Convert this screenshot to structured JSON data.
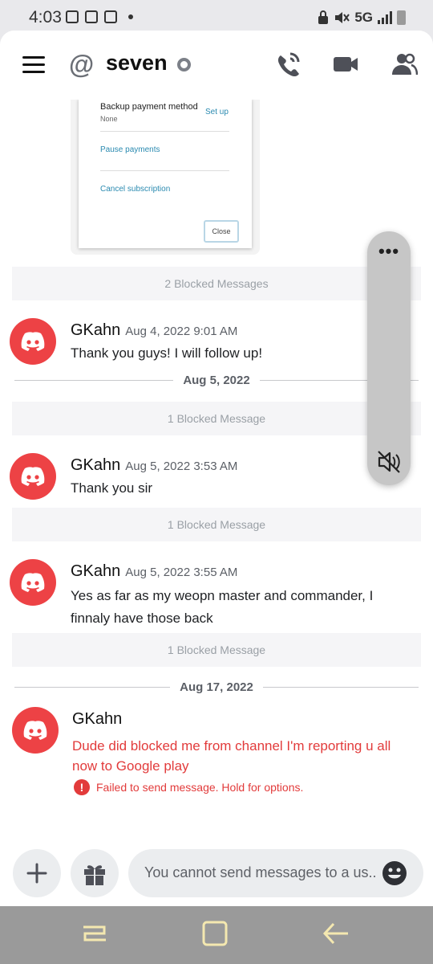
{
  "status_bar": {
    "time": "4:03",
    "network": "5G"
  },
  "header": {
    "channel_name": "seven",
    "at_symbol": "@"
  },
  "embed": {
    "backup_label": "Backup payment method",
    "backup_value": "None",
    "setup_link": "Set up",
    "pause_link": "Pause payments",
    "cancel_link": "Cancel subscription",
    "close_button": "Close"
  },
  "messages": [
    {
      "blocked": "2 Blocked Messages"
    },
    {
      "author": "GKahn",
      "timestamp": "Aug 4, 2022 9:01 AM",
      "text": "Thank you guys! I will follow up!"
    },
    {
      "date_divider": "Aug 5, 2022"
    },
    {
      "blocked": "1 Blocked Message"
    },
    {
      "author": "GKahn",
      "timestamp": "Aug 5, 2022 3:53 AM",
      "text": "Thank you sir"
    },
    {
      "blocked": "1 Blocked Message"
    },
    {
      "author": "GKahn",
      "timestamp": "Aug 5, 2022 3:55 AM",
      "text": "Yes as far as my weopn master and commander, I finnaly have those back"
    },
    {
      "blocked": "1 Blocked Message"
    },
    {
      "date_divider": "Aug 17, 2022"
    },
    {
      "author": "GKahn",
      "text": "Dude did blocked me from channel I'm reporting u all now to Google play",
      "error": "Failed to send message. Hold for options."
    }
  ],
  "volume_panel": {
    "more": "•••"
  },
  "composer": {
    "placeholder": "You cannot send messages to a us..."
  },
  "colors": {
    "discord_red": "#ed4245",
    "error_red": "#e23b3b",
    "link_teal": "#2a8ab0"
  },
  "icons": {
    "menu": "hamburger-icon",
    "at": "at-icon",
    "call": "phone-call-icon",
    "video": "video-camera-icon",
    "members": "members-icon",
    "add": "plus-icon",
    "gift": "gift-icon",
    "emoji": "emoji-icon",
    "mute": "speaker-muted-icon"
  }
}
